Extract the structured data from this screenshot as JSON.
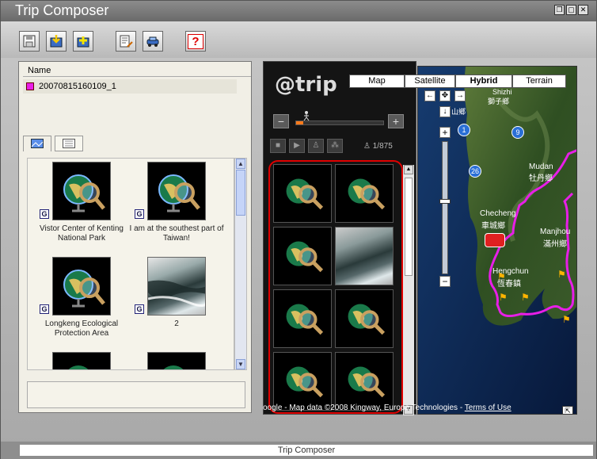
{
  "window": {
    "title": "Trip Composer",
    "status_title": "Trip Composer"
  },
  "toolbar": {
    "buttons": [
      {
        "icon": "floppy-disk-icon"
      },
      {
        "icon": "import-icon"
      },
      {
        "icon": "add-photo-icon"
      },
      {
        "icon": "edit-notes-icon"
      },
      {
        "icon": "car-icon"
      },
      {
        "icon": "help-icon",
        "label": "?"
      }
    ]
  },
  "tracks": {
    "header": "Name",
    "items": [
      {
        "name": "20070815160109_1",
        "color": "#e81ee8"
      }
    ]
  },
  "thumbnails": [
    {
      "label": "Vistor Center of Kenting National Park",
      "badge": "G",
      "kind": "globe"
    },
    {
      "label": "I am at the southest part of Taiwan!",
      "badge": "G",
      "kind": "globe"
    },
    {
      "label": "Longkeng Ecological Protection Area",
      "badge": "G",
      "kind": "globe"
    },
    {
      "label": "2",
      "badge": "G",
      "kind": "photo"
    }
  ],
  "player": {
    "logo": "@trip",
    "speed_minus": "−",
    "speed_plus": "+",
    "speed_level": 0.08,
    "counter": "1/875"
  },
  "map": {
    "types": [
      {
        "label": "Map",
        "selected": false
      },
      {
        "label": "Satellite",
        "selected": false
      },
      {
        "label": "Hybrid",
        "selected": true
      },
      {
        "label": "Terrain",
        "selected": false
      }
    ],
    "zoom_in": "+",
    "zoom_out": "−",
    "zoom_level": 0.45,
    "labels": [
      "Shizhi",
      "獅子鄉",
      "山鄉",
      "Mudan",
      "牡丹鄉",
      "Checheng",
      "車城鄉",
      "Manjhou",
      "滿州鄉",
      "Hengchun",
      "恆春鎮"
    ],
    "roads": [
      "1",
      "9",
      "26"
    ],
    "credit": "oogle - Map data ©2008 Kingway, Europa Technologies - ",
    "terms": "Terms of Use"
  },
  "colors": {
    "track_magenta": "#e81ee8",
    "selection_red": "#e00000",
    "speed_orange": "#ff7a1a"
  }
}
